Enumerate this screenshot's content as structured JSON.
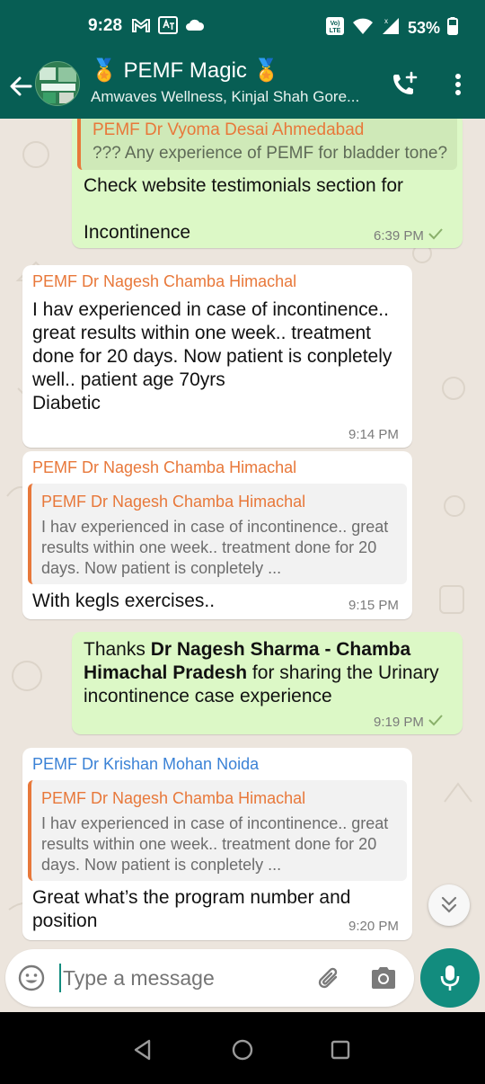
{
  "status_bar": {
    "time": "9:28",
    "battery": "53%",
    "icons": [
      "gmail-icon",
      "translate-icon",
      "cloud-icon",
      "volte-icon",
      "wifi-icon",
      "signal-icon",
      "battery-icon"
    ]
  },
  "header": {
    "title": "🏅 PEMF Magic 🏅",
    "subtitle": "Amwaves Wellness, Kinjal Shah Gore...",
    "icons": [
      "back-arrow-icon",
      "add-call-icon",
      "more-vert-icon"
    ]
  },
  "messages": [
    {
      "type": "outgoing",
      "quote": {
        "sender": "PEMF Dr Vyoma Desai Ahmedabad",
        "text": "??? Any experience of PEMF for bladder tone?"
      },
      "text": "Check website testimonials section for\n\nIncontinence",
      "time": "6:39 PM",
      "status": "sent"
    },
    {
      "type": "incoming",
      "sender": "PEMF Dr Nagesh Chamba Himachal",
      "text": "I hav experienced in case of incontinence.. great results within one week.. treatment done for 20 days. Now patient is conpletely well.. patient age 70yrs\nDiabetic",
      "time": "9:14 PM"
    },
    {
      "type": "incoming",
      "sender": "PEMF Dr Nagesh Chamba Himachal",
      "quote": {
        "sender": "PEMF Dr Nagesh Chamba Himachal",
        "text": "I hav experienced in case of incontinence.. great results within one week.. treatment done for 20 days. Now patient is conpletely ..."
      },
      "text": "With kegls exercises..",
      "time": "9:15 PM"
    },
    {
      "type": "outgoing",
      "text_prefix": "Thanks ",
      "text_bold": "Dr Nagesh Sharma - Chamba Himachal Pradesh",
      "text_suffix": " for sharing the Urinary incontinence case experience",
      "time": "9:19 PM",
      "status": "sent"
    },
    {
      "type": "incoming",
      "sender": "PEMF Dr Krishan Mohan Noida",
      "quote": {
        "sender": "PEMF Dr Nagesh Chamba Himachal",
        "text": "I hav experienced in case of incontinence.. great results within one week.. treatment done for 20 days. Now patient is conpletely ..."
      },
      "text": "Great what’s the program number and position",
      "time": "9:20 PM"
    }
  ],
  "composer": {
    "placeholder": "Type a message",
    "icons": [
      "emoji-icon",
      "attach-icon",
      "camera-icon",
      "mic-icon"
    ]
  },
  "navbar": {
    "icons": [
      "nav-back-icon",
      "nav-home-icon",
      "nav-recents-icon"
    ]
  },
  "colors": {
    "header_bg": "#075e54",
    "chat_bg": "#ece5dd",
    "outgoing_bubble": "#dcf8c6",
    "incoming_bubble": "#ffffff",
    "accent": "#128c7e",
    "sender_orange": "#e8783a",
    "sender_blue": "#3b82d6",
    "tick_green": "#8ab06b"
  }
}
